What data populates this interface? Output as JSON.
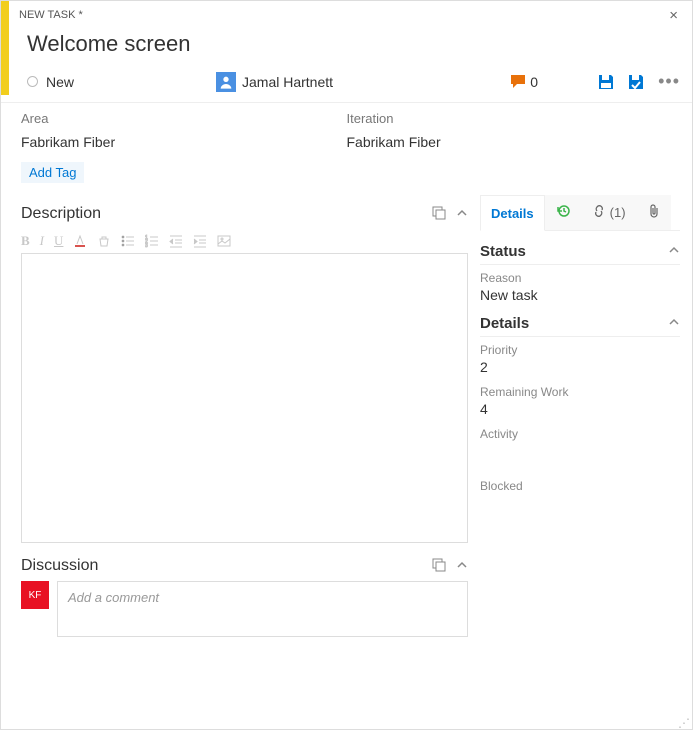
{
  "topbar": {
    "type_label": "NEW TASK *"
  },
  "title": "Welcome screen",
  "state": {
    "label": "New"
  },
  "assignee": {
    "name": "Jamal Hartnett"
  },
  "comments": {
    "count": "0"
  },
  "area": {
    "label": "Area",
    "value": "Fabrikam Fiber"
  },
  "iteration": {
    "label": "Iteration",
    "value": "Fabrikam Fiber"
  },
  "tags": {
    "add_label": "Add Tag"
  },
  "description": {
    "heading": "Description"
  },
  "discussion": {
    "heading": "Discussion",
    "avatar_initials": "KF",
    "placeholder": "Add a comment"
  },
  "tabs": {
    "details": "Details",
    "links": "(1)"
  },
  "status": {
    "heading": "Status",
    "reason_label": "Reason",
    "reason_value": "New task"
  },
  "details": {
    "heading": "Details",
    "priority_label": "Priority",
    "priority_value": "2",
    "remaining_label": "Remaining Work",
    "remaining_value": "4",
    "activity_label": "Activity",
    "blocked_label": "Blocked"
  }
}
